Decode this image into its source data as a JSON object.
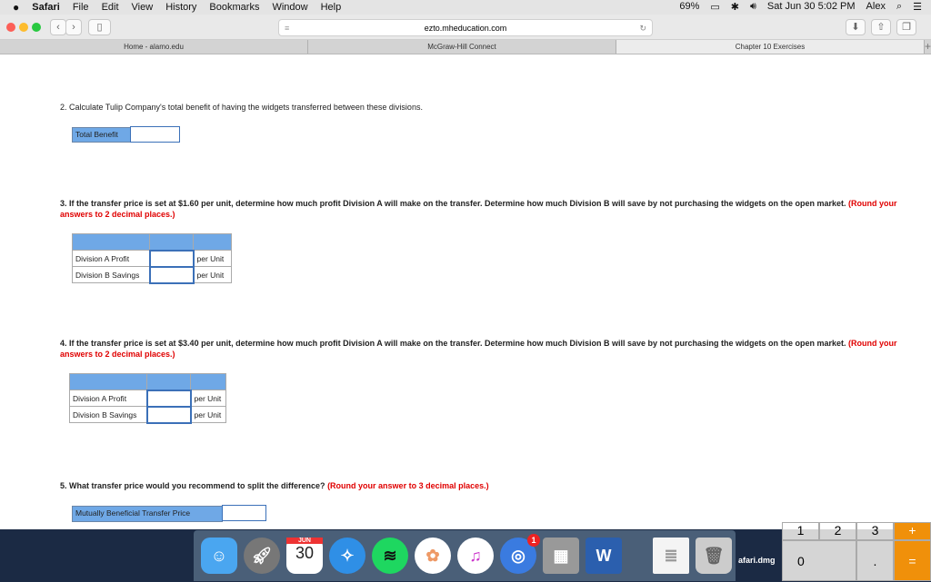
{
  "menubar": {
    "apple": "",
    "items": [
      "Safari",
      "File",
      "Edit",
      "View",
      "History",
      "Bookmarks",
      "Window",
      "Help"
    ],
    "battery": "69%",
    "datetime": "Sat Jun 30  5:02 PM",
    "user": "Alex"
  },
  "browser": {
    "url": "ezto.mheducation.com",
    "tabs": [
      {
        "label": "Home - alamo.edu",
        "active": false
      },
      {
        "label": "McGraw-Hill Connect",
        "active": false
      },
      {
        "label": "Chapter 10 Exercises",
        "active": true
      }
    ],
    "new_tab": "+"
  },
  "q2": {
    "text": "2. Calculate Tulip Company's total benefit of having the widgets transferred between these divisions.",
    "label": "Total Benefit",
    "value": ""
  },
  "q3": {
    "text": "3. If the transfer price is set at $1.60 per unit, determine how much profit Division A will make on the transfer. Determine how much Division B will save by not purchasing the widgets on the open market.",
    "note": "(Round your answers to 2 decimal places.)",
    "rows": [
      {
        "label": "Division A Profit",
        "value": "",
        "unit": "per Unit"
      },
      {
        "label": "Division B Savings",
        "value": "",
        "unit": "per Unit"
      }
    ]
  },
  "q4": {
    "text": "4. If the transfer price is set at $3.40 per unit, determine how much profit Division A will make on the transfer. Determine how much Division B will save by not purchasing the widgets on the open market.",
    "note": "(Round your answers to 2 decimal places.)",
    "rows": [
      {
        "label": "Division A Profit",
        "value": "",
        "unit": "per Unit"
      },
      {
        "label": "Division B Savings",
        "value": "",
        "unit": "per Unit"
      }
    ]
  },
  "q5": {
    "text": "5. What transfer price would you recommend to split the difference?",
    "note": "(Round your answer to 3 decimal places.)",
    "label": "Mutually Beneficial Transfer Price",
    "value": ""
  },
  "dock": {
    "calendar_month": "JUN",
    "calendar_day": "30",
    "badge": "1",
    "word": "W",
    "desktop_file": "afari.dmg"
  },
  "calculator": {
    "keys": [
      "1",
      "2",
      "3",
      "+",
      "0",
      ".",
      "="
    ]
  }
}
